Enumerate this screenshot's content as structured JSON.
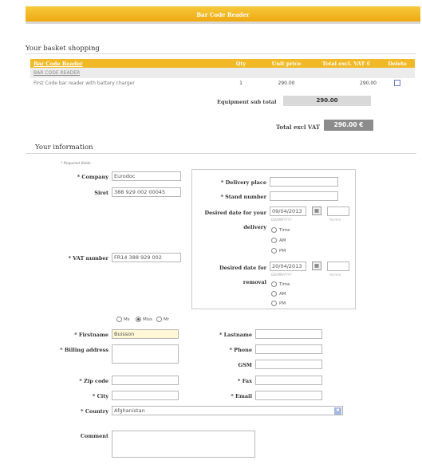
{
  "header": {
    "title": "Bar Code Reader"
  },
  "basket": {
    "title": "Your basket shopping",
    "columns": [
      "Bar Code Reader",
      "Qty",
      "Unit price",
      "Total excl. VAT €",
      "Delete"
    ],
    "group_label": "BAR CODE READER",
    "rows": [
      {
        "product": "First Code bar reader with battery charger",
        "qty": "1",
        "unit_price": "290.00",
        "total": "290.00"
      }
    ],
    "subtotal_label": "Equipment sub total",
    "subtotal_value": "290.00",
    "total_label": "Total excl VAT",
    "total_value": "290.00 €"
  },
  "info": {
    "title": "Your information",
    "required_note": "* Required fields",
    "company_label": "* Company",
    "company_value": "Eurodoc",
    "siret_label": "Siret",
    "siret_value": "388 929 002 00045",
    "vat_label": "* VAT number",
    "vat_value": "FR14 388 929 002",
    "delivery_place_label": "* Delivery place",
    "stand_label": "* Stand number",
    "delivery_date_label_1": "Desired date for your",
    "delivery_date_label_2": "delivery",
    "delivery_date_value": "09/04/2013",
    "removal_date_label_1": "Desired date for",
    "removal_date_label_2": "removal",
    "removal_date_value": "20/04/2013",
    "date_hint": "DD/MM/YYYY",
    "time_hint": "hh:mm",
    "time_options": [
      "Time",
      "AM",
      "PM"
    ],
    "civility": [
      "Ms",
      "Miss",
      "Mr"
    ],
    "civility_selected": "Miss",
    "firstname_label": "* Firstname",
    "firstname_value": "Buisson",
    "lastname_label": "* Lastname",
    "billing_label": "* Billing address",
    "phone_label": "* Phone",
    "gsm_label": "GSM",
    "zip_label": "* Zip code",
    "fax_label": "* Fax",
    "city_label": "* City",
    "email_label": "* Email",
    "country_label": "* Country",
    "country_value": "Afghanistan",
    "comment_label": "Comment"
  }
}
